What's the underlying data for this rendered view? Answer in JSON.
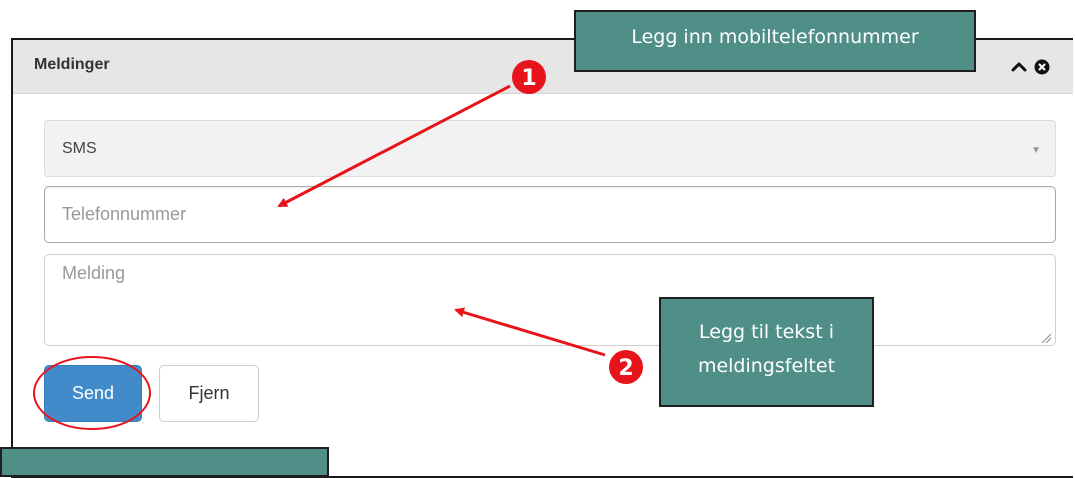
{
  "panel": {
    "title": "Meldinger",
    "icons": [
      "chevron-up-icon",
      "close-circle-icon"
    ]
  },
  "form": {
    "channel_select": {
      "value": "SMS"
    },
    "phone": {
      "placeholder": "Telefonnummer",
      "value": ""
    },
    "message": {
      "placeholder": "Melding",
      "value": ""
    },
    "send_label": "Send",
    "clear_label": "Fjern"
  },
  "annotations": {
    "callout_phone": "Legg inn mobiltelefonnummer",
    "callout_message_line1": "Legg til tekst i",
    "callout_message_line2": "meldingsfeltet",
    "step_1": "1",
    "step_2": "2"
  },
  "colors": {
    "callout_bg": "#4f8f87",
    "arrow_red": "#e8141c",
    "send_button": "#428bca",
    "header_bg": "#e6e6e6"
  }
}
